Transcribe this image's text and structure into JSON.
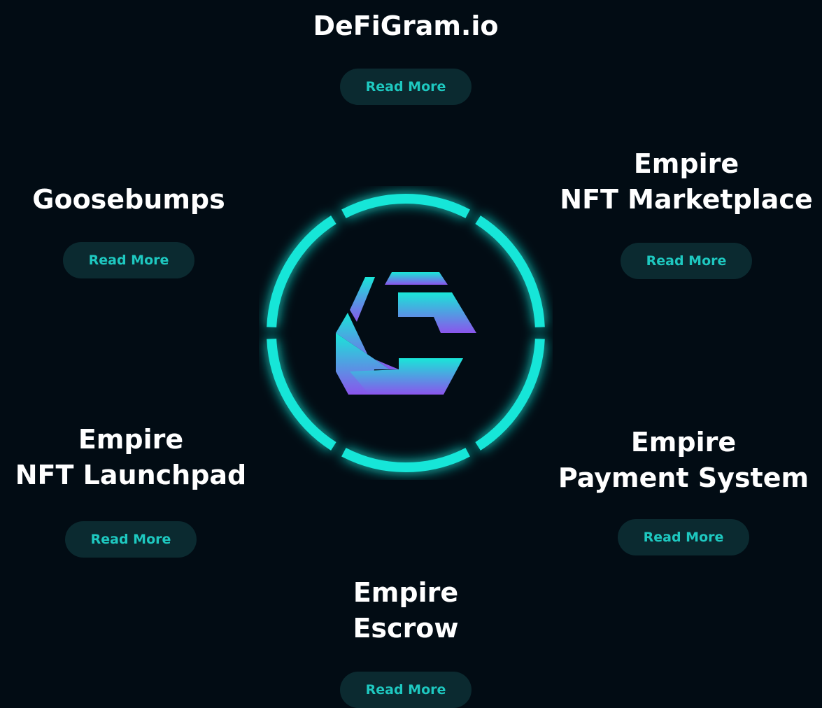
{
  "colors": {
    "background": "#020c14",
    "ring": "#19e6d8",
    "button_background": "#0b2a30",
    "button_text": "#1ec8c0",
    "title": "#ffffff",
    "logo_gradient_top": "#19e6d8",
    "logo_gradient_bottom": "#8a55ec"
  },
  "logo": {
    "icon": "hexagon-e-logo-icon"
  },
  "products": [
    {
      "id": "defigram",
      "title_lines": [
        "DeFiGram.io"
      ],
      "button_label": "Read More"
    },
    {
      "id": "goosebumps",
      "title_lines": [
        "Goosebumps"
      ],
      "button_label": "Read More"
    },
    {
      "id": "nft-marketplace",
      "title_lines": [
        "Empire",
        "NFT Marketplace"
      ],
      "button_label": "Read More"
    },
    {
      "id": "nft-launchpad",
      "title_lines": [
        "Empire",
        "NFT Launchpad"
      ],
      "button_label": "Read More"
    },
    {
      "id": "payment-system",
      "title_lines": [
        "Empire",
        "Payment System"
      ],
      "button_label": "Read More"
    },
    {
      "id": "escrow",
      "title_lines": [
        "Empire",
        "Escrow"
      ],
      "button_label": "Read More"
    }
  ]
}
